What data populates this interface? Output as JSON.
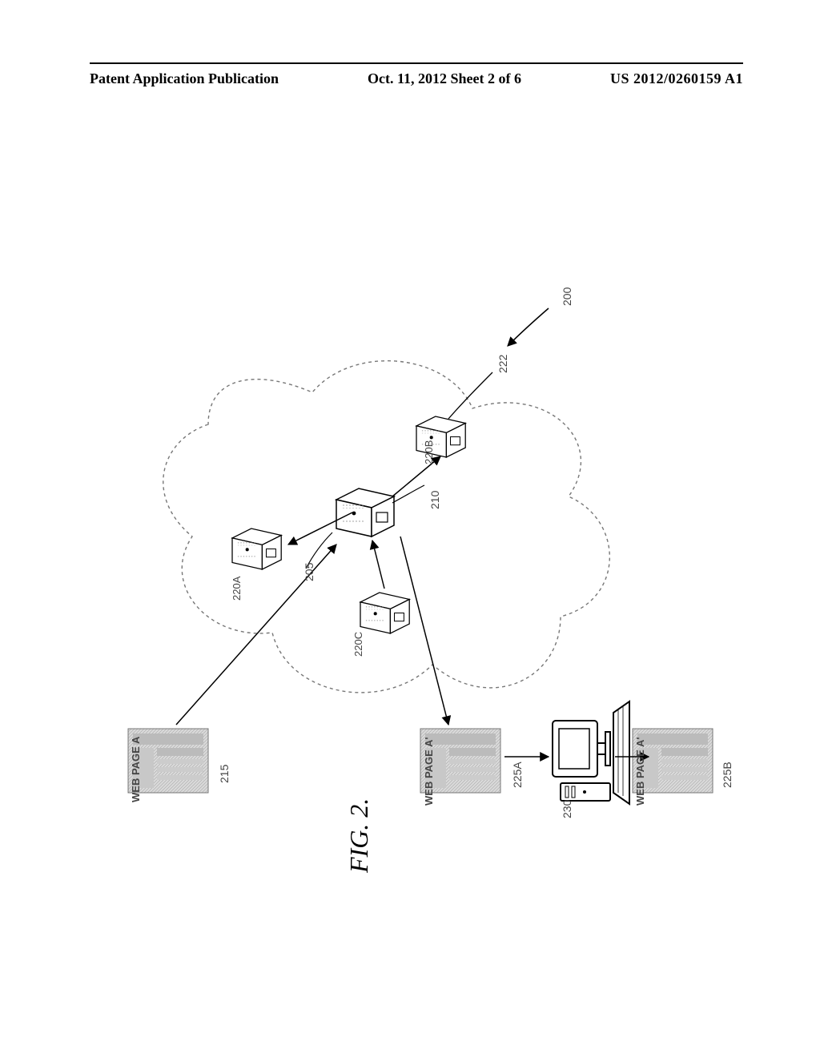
{
  "header": {
    "left": "Patent Application Publication",
    "mid": "Oct. 11, 2012  Sheet 2 of 6",
    "right": "US 2012/0260159 A1"
  },
  "labels": {
    "webpage_a": "WEB PAGE A",
    "webpage_ap1": "WEB PAGE A'",
    "webpage_ap2": "WEB PAGE A'",
    "ref_200": "200",
    "ref_205": "205",
    "ref_210": "210",
    "ref_215": "215",
    "ref_220a": "220A",
    "ref_220b": "220B",
    "ref_220c": "220C",
    "ref_222": "222",
    "ref_225a": "225A",
    "ref_225b": "225B",
    "ref_230": "230"
  },
  "figure_caption": "FIG. 2."
}
